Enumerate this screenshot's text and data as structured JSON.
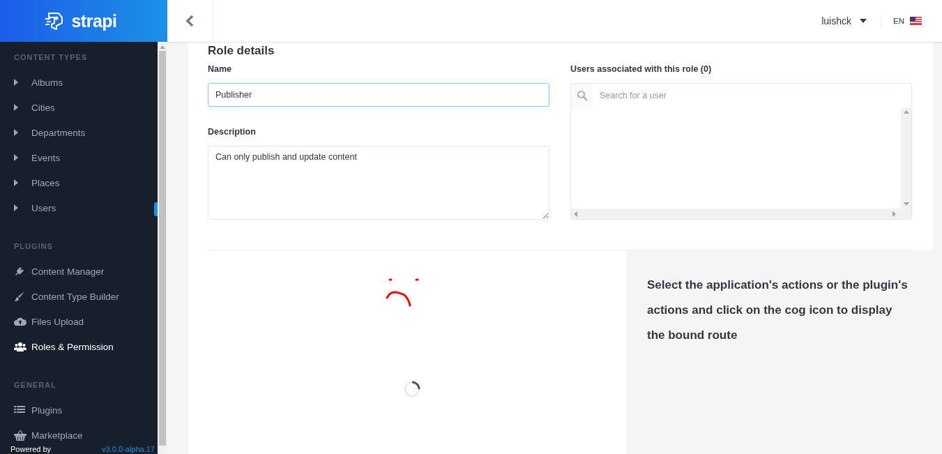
{
  "brand": {
    "name": "strapi"
  },
  "sidebar": {
    "sections": [
      {
        "title": "CONTENT TYPES",
        "items": [
          {
            "label": "Albums",
            "kind": "caret",
            "selected": false
          },
          {
            "label": "Cities",
            "kind": "caret",
            "selected": false
          },
          {
            "label": "Departments",
            "kind": "caret",
            "selected": false
          },
          {
            "label": "Events",
            "kind": "caret",
            "selected": false
          },
          {
            "label": "Places",
            "kind": "caret",
            "selected": false
          },
          {
            "label": "Users",
            "kind": "caret",
            "selected": false
          }
        ]
      },
      {
        "title": "PLUGINS",
        "items": [
          {
            "label": "Content Manager",
            "kind": "plug",
            "selected": false
          },
          {
            "label": "Content Type Builder",
            "kind": "brush",
            "selected": false
          },
          {
            "label": "Files Upload",
            "kind": "cloud",
            "selected": false
          },
          {
            "label": "Roles & Permission",
            "kind": "users",
            "selected": true
          }
        ]
      },
      {
        "title": "GENERAL",
        "items": [
          {
            "label": "Plugins",
            "kind": "list",
            "selected": false
          },
          {
            "label": "Marketplace",
            "kind": "basket",
            "selected": false
          }
        ]
      }
    ],
    "footer": {
      "powered": "Powered by",
      "version": "v3.0.0-alpha.17"
    }
  },
  "header": {
    "user": "luishck",
    "language": "EN"
  },
  "role_details": {
    "heading": "Role details",
    "name_label": "Name",
    "name_value": "Publisher",
    "description_label": "Description",
    "description_value": "Can only publish and update content",
    "users_label": "Users associated with this role (0)",
    "search_placeholder": "Search for a user"
  },
  "routes_panel": {
    "text": "Select the application's actions or the plugin's actions and click on the cog icon to display the bound route"
  }
}
